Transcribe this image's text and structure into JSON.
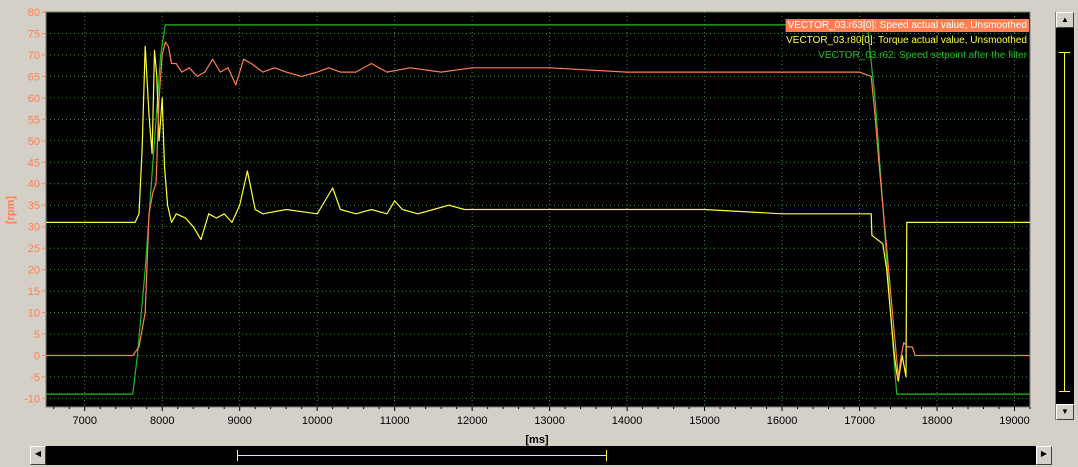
{
  "colors": {
    "background": "#d4d0c8",
    "plot_background": "#000000",
    "grid": "#3d9140",
    "speed_actual": "#ff7f50",
    "torque_actual": "#ffff33",
    "speed_setpoint": "#22bb22",
    "y_ticks": "#ff7f50"
  },
  "chart_data": {
    "type": "line",
    "title": "",
    "xlabel": "[ms]",
    "ylabel": "[rpm]",
    "xlim": [
      6500,
      19200
    ],
    "ylim": [
      -12,
      80
    ],
    "x_ticks": [
      7000,
      8000,
      9000,
      10000,
      11000,
      12000,
      13000,
      14000,
      15000,
      16000,
      17000,
      18000,
      19000
    ],
    "y_ticks": [
      -10,
      -5,
      0,
      5,
      10,
      15,
      20,
      25,
      30,
      35,
      40,
      45,
      50,
      55,
      60,
      65,
      70,
      75,
      80
    ],
    "grid": true,
    "legend_position": "top-right",
    "series": [
      {
        "name": "VECTOR_03.r63[0]: Speed actual value, Unsmoothed",
        "color": "#ff7f50",
        "x": [
          6500,
          7620,
          7700,
          7780,
          7830,
          7880,
          7920,
          7960,
          8000,
          8040,
          8080,
          8120,
          8180,
          8250,
          8350,
          8450,
          8550,
          8650,
          8750,
          8850,
          8950,
          9050,
          9150,
          9300,
          9450,
          9600,
          9800,
          10000,
          10150,
          10300,
          10500,
          10700,
          10900,
          11200,
          11600,
          12000,
          13000,
          14000,
          15000,
          16000,
          17000,
          17150,
          17200,
          17250,
          17300,
          17350,
          17400,
          17450,
          17500,
          17530,
          17570,
          17620,
          17680,
          17720,
          17760,
          17800,
          19200
        ],
        "y": [
          0,
          0,
          2,
          10,
          33,
          38,
          40,
          60,
          70,
          73,
          72,
          68,
          68,
          66,
          67,
          65,
          66,
          69,
          66,
          67,
          63,
          69,
          68,
          66,
          67,
          66,
          65,
          66,
          67,
          66,
          66,
          68,
          66,
          67,
          66,
          67,
          67,
          66,
          66,
          66,
          66,
          65,
          56,
          45,
          35,
          25,
          15,
          5,
          -5,
          -1,
          3,
          2,
          2,
          0,
          0,
          0,
          0
        ]
      },
      {
        "name": "VECTOR_03.r80[0]: Torque actual value, Unsmoothed",
        "color": "#ffff33",
        "x": [
          6500,
          7650,
          7700,
          7740,
          7780,
          7830,
          7870,
          7900,
          7930,
          7960,
          8000,
          8030,
          8070,
          8120,
          8180,
          8300,
          8400,
          8500,
          8600,
          8700,
          8800,
          8900,
          9000,
          9100,
          9200,
          9300,
          9600,
          10000,
          10200,
          10300,
          10500,
          10700,
          10900,
          11000,
          11100,
          11300,
          11500,
          11700,
          11900,
          12000,
          13000,
          14000,
          15000,
          16000,
          17000,
          17150,
          17160,
          17300,
          17350,
          17400,
          17450,
          17480,
          17500,
          17550,
          17600,
          17610,
          19200
        ],
        "y": [
          31,
          31,
          33,
          48,
          72,
          56,
          47,
          71,
          65,
          50,
          60,
          44,
          35,
          31,
          33,
          32,
          30,
          27,
          33,
          32,
          33,
          31,
          35,
          43,
          34,
          33,
          34,
          33,
          39,
          34,
          33,
          34,
          33,
          36,
          34,
          33,
          34,
          35,
          34,
          34,
          34,
          34,
          34,
          33,
          33,
          33,
          28,
          26,
          20,
          10,
          0,
          -4,
          -6,
          0,
          -5,
          31,
          31
        ]
      },
      {
        "name": "VECTOR_03.r62: Speed setpoint after the filter",
        "color": "#22bb22",
        "x": [
          6500,
          7620,
          7680,
          7780,
          7880,
          7980,
          8040,
          8060,
          17100,
          17200,
          17300,
          17400,
          17480,
          17500,
          19200
        ],
        "y": [
          -9,
          -9,
          0,
          20,
          45,
          70,
          77,
          77,
          77,
          60,
          35,
          10,
          -9,
          -9,
          -9
        ]
      }
    ]
  }
}
